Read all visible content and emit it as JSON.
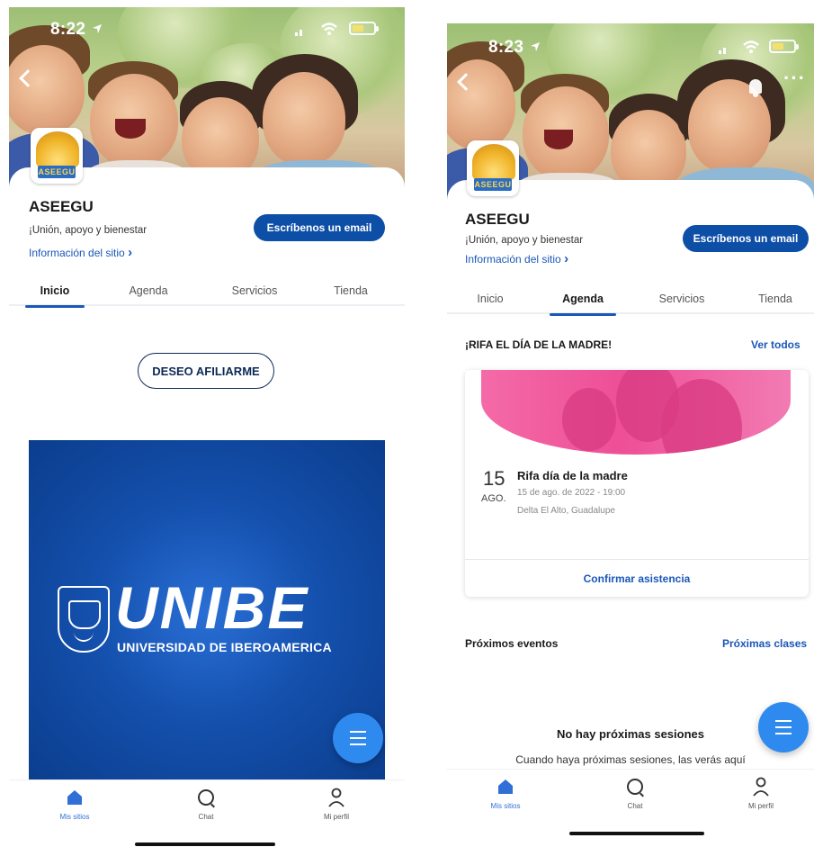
{
  "left": {
    "status_time": "8:22",
    "site_name": "ASEEGU",
    "tagline": "¡Unión, apoyo y bienestar",
    "info_link": "Información del sitio",
    "info_chevron": "›",
    "email_button": "Escríbenos un email",
    "tabs": [
      {
        "label": "Inicio",
        "active": true
      },
      {
        "label": "Agenda",
        "active": false
      },
      {
        "label": "Servicios",
        "active": false
      },
      {
        "label": "Tienda",
        "active": false
      }
    ],
    "affiliate_button": "DESEO AFILIARME",
    "banner": {
      "brand": "UNIBE",
      "university": "UNIVERSIDAD DE IBEROAMERICA"
    },
    "nav": [
      {
        "label": "Mis sitios",
        "icon": "home-icon",
        "active": true
      },
      {
        "label": "Chat",
        "icon": "chat-icon",
        "active": false
      },
      {
        "label": "Mi perfil",
        "icon": "person-icon",
        "active": false
      }
    ]
  },
  "right": {
    "status_time": "8:23",
    "site_name": "ASEEGU",
    "tagline": "¡Unión, apoyo y bienestar",
    "info_link": "Información del sitio",
    "info_chevron": "›",
    "email_button": "Escríbenos un email",
    "tabs": [
      {
        "label": "Inicio",
        "active": false
      },
      {
        "label": "Agenda",
        "active": true
      },
      {
        "label": "Servicios",
        "active": false
      },
      {
        "label": "Tienda",
        "active": false
      }
    ],
    "section_title": "¡RIFA EL DÍA DE LA MADRE!",
    "see_all": "Ver todos",
    "event": {
      "day": "15",
      "month": "AGO.",
      "title": "Rifa día de la madre",
      "date": "15 de ago. de 2022 - 19:00",
      "place": "Delta El Alto, Guadalupe",
      "rsvp": "Confirmar asistencia"
    },
    "upcoming_title": "Próximos eventos",
    "upcoming_link": "Próximas clases",
    "empty_title": "No hay próximas sesiones",
    "empty_sub": "Cuando haya próximas sesiones, las verás aquí",
    "nav": [
      {
        "label": "Mis sitios",
        "icon": "home-icon",
        "active": true
      },
      {
        "label": "Chat",
        "icon": "chat-icon",
        "active": false
      },
      {
        "label": "Mi perfil",
        "icon": "person-icon",
        "active": false
      }
    ]
  },
  "logo_text": "ASEEGU",
  "colors": {
    "primary_blue": "#0d4ea6",
    "link_blue": "#1a57b8",
    "fab_blue": "#2f8af0",
    "banner_blue": "#1450ad",
    "event_pink": "#ee4f96"
  }
}
